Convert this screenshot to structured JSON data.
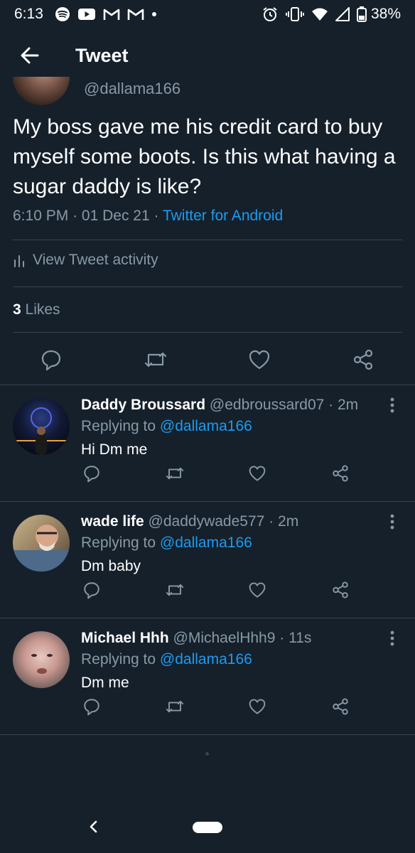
{
  "status_bar": {
    "time": "6:13",
    "battery": "38%",
    "icons_left": [
      "spotify-icon",
      "youtube-icon",
      "gmail-icon",
      "gmail-icon",
      "dot-icon"
    ],
    "icons_right": [
      "alarm-icon",
      "vibrate-icon",
      "wifi-icon",
      "signal-icon",
      "battery-icon"
    ]
  },
  "header": {
    "title": "Tweet"
  },
  "tweet": {
    "handle": "@dallama166",
    "text": "My boss gave me his credit card to buy myself some boots. Is this what having a sugar daddy is like?",
    "time": "6:10 PM",
    "separator": "·",
    "date": "01 Dec 21",
    "source": "Twitter for Android",
    "activity_label": "View Tweet activity",
    "likes_count": "3",
    "likes_label": "Likes"
  },
  "replies": [
    {
      "name": "Daddy Broussard",
      "handle": "@edbroussard07",
      "time": "2m",
      "replying_prefix": "Replying to",
      "replying_to": "@dallama166",
      "text": "Hi Dm me"
    },
    {
      "name": "wade life",
      "handle": "@daddywade577",
      "time": "2m",
      "replying_prefix": "Replying to",
      "replying_to": "@dallama166",
      "text": "Dm baby"
    },
    {
      "name": "Michael Hhh",
      "handle": "@MichaelHhh9",
      "time": "11s",
      "replying_prefix": "Replying to",
      "replying_to": "@dallama166",
      "text": "Dm me"
    }
  ],
  "colors": {
    "background": "#15202b",
    "text": "#ffffff",
    "secondary": "#8899a6",
    "accent": "#1d9bf0",
    "divider": "#38444d"
  }
}
